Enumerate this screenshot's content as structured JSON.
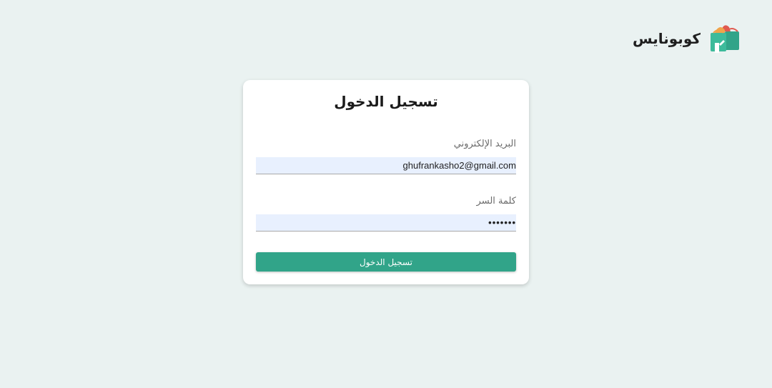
{
  "brand": {
    "name": "كوبونايس",
    "logo_icon": "shopping-bags-logo-icon",
    "colors": {
      "primary": "#31a489",
      "accent_red": "#e05a4f",
      "accent_orange": "#f0a44a"
    }
  },
  "login_form": {
    "title": "تسجيل الدخول",
    "email_label": "البريد الإلكتروني",
    "email_value": "ghufrankasho2@gmail.com",
    "password_label": "كلمة السر",
    "password_value": "•••••••",
    "submit_label": "تسجيل الدخول"
  },
  "theme": {
    "background": "#eaf2f1",
    "card_background": "#ffffff",
    "input_background": "#e8f0fe",
    "button_color": "#31a489"
  }
}
